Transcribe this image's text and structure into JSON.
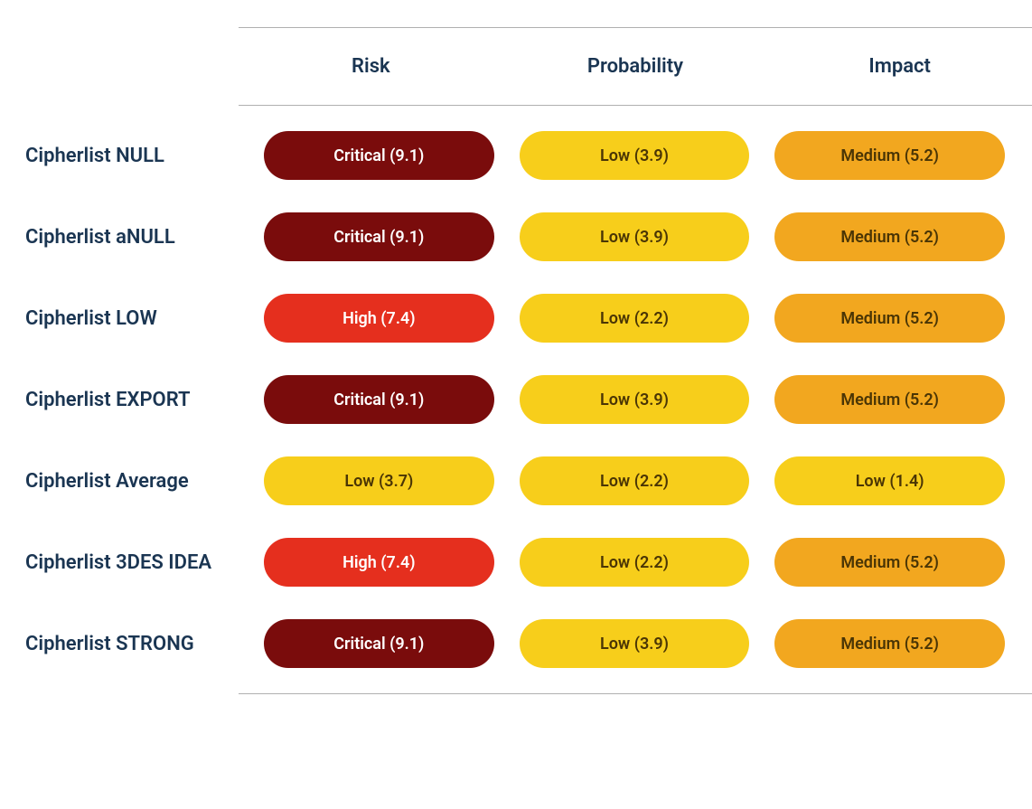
{
  "chart_data": {
    "type": "table",
    "title": "",
    "columns": [
      "Risk",
      "Probability",
      "Impact"
    ],
    "rows": [
      {
        "label": "Cipherlist NULL",
        "risk": {
          "level": "Critical",
          "value": 9.1
        },
        "probability": {
          "level": "Low",
          "value": 3.9
        },
        "impact": {
          "level": "Medium",
          "value": 5.2
        }
      },
      {
        "label": "Cipherlist aNULL",
        "risk": {
          "level": "Critical",
          "value": 9.1
        },
        "probability": {
          "level": "Low",
          "value": 3.9
        },
        "impact": {
          "level": "Medium",
          "value": 5.2
        }
      },
      {
        "label": "Cipherlist LOW",
        "risk": {
          "level": "High",
          "value": 7.4
        },
        "probability": {
          "level": "Low",
          "value": 2.2
        },
        "impact": {
          "level": "Medium",
          "value": 5.2
        }
      },
      {
        "label": "Cipherlist EXPORT",
        "risk": {
          "level": "Critical",
          "value": 9.1
        },
        "probability": {
          "level": "Low",
          "value": 3.9
        },
        "impact": {
          "level": "Medium",
          "value": 5.2
        }
      },
      {
        "label": "Cipherlist Average",
        "risk": {
          "level": "Low",
          "value": 3.7
        },
        "probability": {
          "level": "Low",
          "value": 2.2
        },
        "impact": {
          "level": "Low",
          "value": 1.4
        }
      },
      {
        "label": "Cipherlist 3DES IDEA",
        "risk": {
          "level": "High",
          "value": 7.4
        },
        "probability": {
          "level": "Low",
          "value": 2.2
        },
        "impact": {
          "level": "Medium",
          "value": 5.2
        }
      },
      {
        "label": "Cipherlist STRONG",
        "risk": {
          "level": "Critical",
          "value": 9.1
        },
        "probability": {
          "level": "Low",
          "value": 3.9
        },
        "impact": {
          "level": "Medium",
          "value": 5.2
        }
      }
    ],
    "colors": {
      "critical": "#7a0c0c",
      "high": "#e52f1e",
      "medium": "#f2a71f",
      "low": "#f7ce1b"
    }
  },
  "headers": {
    "risk": "Risk",
    "probability": "Probability",
    "impact": "Impact"
  },
  "rows": [
    {
      "label": "Cipherlist NULL",
      "risk_text": "Critical (9.1)",
      "risk_class": "critical",
      "probability_text": "Low (3.9)",
      "probability_class": "low",
      "impact_text": "Medium (5.2)",
      "impact_class": "medium"
    },
    {
      "label": "Cipherlist aNULL",
      "risk_text": "Critical (9.1)",
      "risk_class": "critical",
      "probability_text": "Low (3.9)",
      "probability_class": "low",
      "impact_text": "Medium (5.2)",
      "impact_class": "medium"
    },
    {
      "label": "Cipherlist LOW",
      "risk_text": "High (7.4)",
      "risk_class": "high",
      "probability_text": "Low (2.2)",
      "probability_class": "low",
      "impact_text": "Medium (5.2)",
      "impact_class": "medium"
    },
    {
      "label": "Cipherlist EXPORT",
      "risk_text": "Critical (9.1)",
      "risk_class": "critical",
      "probability_text": "Low (3.9)",
      "probability_class": "low",
      "impact_text": "Medium (5.2)",
      "impact_class": "medium"
    },
    {
      "label": "Cipherlist Average",
      "risk_text": "Low (3.7)",
      "risk_class": "low",
      "probability_text": "Low (2.2)",
      "probability_class": "low",
      "impact_text": "Low (1.4)",
      "impact_class": "low"
    },
    {
      "label": "Cipherlist 3DES IDEA",
      "risk_text": "High (7.4)",
      "risk_class": "high",
      "probability_text": "Low (2.2)",
      "probability_class": "low",
      "impact_text": "Medium (5.2)",
      "impact_class": "medium"
    },
    {
      "label": "Cipherlist STRONG",
      "risk_text": "Critical (9.1)",
      "risk_class": "critical",
      "probability_text": "Low (3.9)",
      "probability_class": "low",
      "impact_text": "Medium (5.2)",
      "impact_class": "medium"
    }
  ]
}
